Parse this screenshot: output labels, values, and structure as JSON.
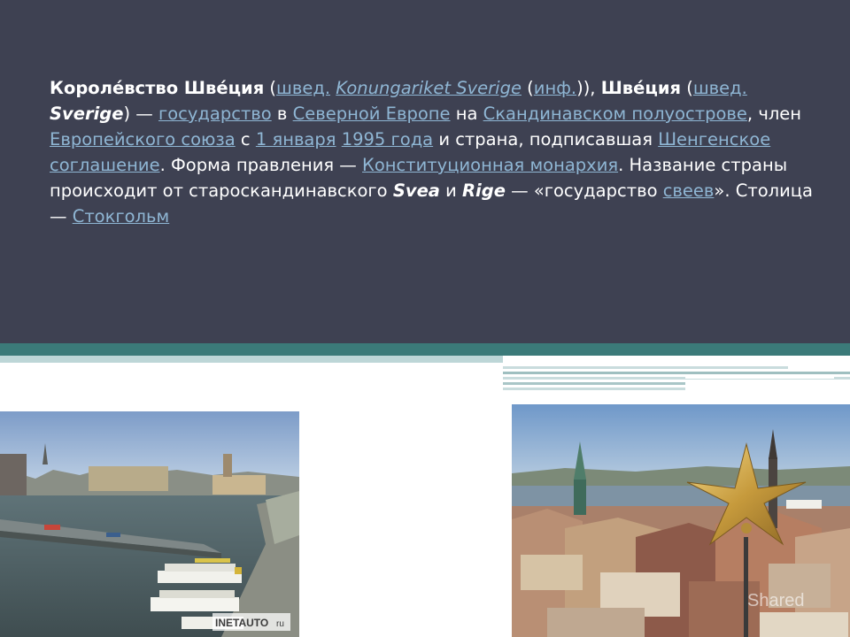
{
  "paragraph": {
    "p1": "Короле́вство Шве́ция",
    "p2": " (",
    "l_shved1": "швед.",
    "p3": " ",
    "l_konung": "Konungariket Sverige",
    "p4": " (",
    "l_inf": "инф.",
    "p5": ")), ",
    "p6": "Шве́ция",
    "p7": " (",
    "l_shved2": "швед.",
    "p8": " ",
    "p9": "Sverige",
    "p10": ") — ",
    "l_gos": "государство",
    "p11": " в ",
    "l_sev": "Северной Европе",
    "p12": " на ",
    "l_skand": "Скандинавском полуострове",
    "p13": ", член ",
    "l_evro": "Европейского союза",
    "p14": " с ",
    "l_jan": "1 января",
    "p15": " ",
    "l_1995": "1995 года",
    "p16": " и страна, подписавшая ",
    "l_sheng": "Шенгенское соглашение",
    "p17": ". Форма правления — ",
    "l_konst": "Конституционная монархия",
    "p18": ". Название страны происходит от староскандинавского ",
    "p19": "Svea",
    "p20": " и ",
    "p21": "Rige",
    "p22": " — «государство ",
    "l_sveev": "свеев",
    "p23": "». Столица — ",
    "l_stock": "Стокгольм"
  },
  "photos": {
    "left_watermark": "INETAUTO",
    "left_watermark_suffix": "ru",
    "right_watermark": "Shared"
  },
  "colors": {
    "panel": "#3e4152",
    "link": "#8fb6d4",
    "teal": "#3b7a79",
    "light_teal": "#bdd6d7"
  }
}
